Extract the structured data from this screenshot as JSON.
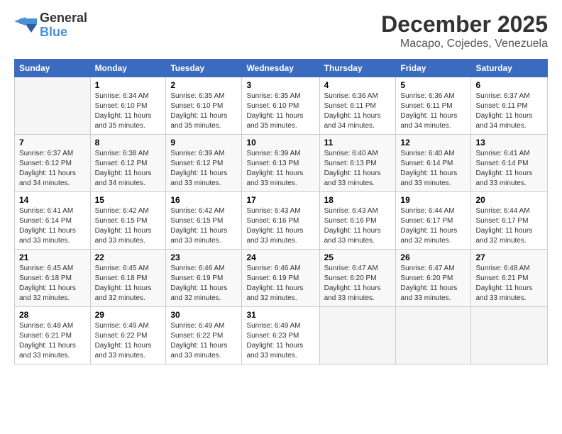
{
  "logo": {
    "general": "General",
    "blue": "Blue"
  },
  "title": {
    "month": "December 2025",
    "location": "Macapo, Cojedes, Venezuela"
  },
  "days_of_week": [
    "Sunday",
    "Monday",
    "Tuesday",
    "Wednesday",
    "Thursday",
    "Friday",
    "Saturday"
  ],
  "weeks": [
    [
      {
        "day": "",
        "info": ""
      },
      {
        "day": "1",
        "info": "Sunrise: 6:34 AM\nSunset: 6:10 PM\nDaylight: 11 hours\nand 35 minutes."
      },
      {
        "day": "2",
        "info": "Sunrise: 6:35 AM\nSunset: 6:10 PM\nDaylight: 11 hours\nand 35 minutes."
      },
      {
        "day": "3",
        "info": "Sunrise: 6:35 AM\nSunset: 6:10 PM\nDaylight: 11 hours\nand 35 minutes."
      },
      {
        "day": "4",
        "info": "Sunrise: 6:36 AM\nSunset: 6:11 PM\nDaylight: 11 hours\nand 34 minutes."
      },
      {
        "day": "5",
        "info": "Sunrise: 6:36 AM\nSunset: 6:11 PM\nDaylight: 11 hours\nand 34 minutes."
      },
      {
        "day": "6",
        "info": "Sunrise: 6:37 AM\nSunset: 6:11 PM\nDaylight: 11 hours\nand 34 minutes."
      }
    ],
    [
      {
        "day": "7",
        "info": "Sunrise: 6:37 AM\nSunset: 6:12 PM\nDaylight: 11 hours\nand 34 minutes."
      },
      {
        "day": "8",
        "info": "Sunrise: 6:38 AM\nSunset: 6:12 PM\nDaylight: 11 hours\nand 34 minutes."
      },
      {
        "day": "9",
        "info": "Sunrise: 6:39 AM\nSunset: 6:12 PM\nDaylight: 11 hours\nand 33 minutes."
      },
      {
        "day": "10",
        "info": "Sunrise: 6:39 AM\nSunset: 6:13 PM\nDaylight: 11 hours\nand 33 minutes."
      },
      {
        "day": "11",
        "info": "Sunrise: 6:40 AM\nSunset: 6:13 PM\nDaylight: 11 hours\nand 33 minutes."
      },
      {
        "day": "12",
        "info": "Sunrise: 6:40 AM\nSunset: 6:14 PM\nDaylight: 11 hours\nand 33 minutes."
      },
      {
        "day": "13",
        "info": "Sunrise: 6:41 AM\nSunset: 6:14 PM\nDaylight: 11 hours\nand 33 minutes."
      }
    ],
    [
      {
        "day": "14",
        "info": "Sunrise: 6:41 AM\nSunset: 6:14 PM\nDaylight: 11 hours\nand 33 minutes."
      },
      {
        "day": "15",
        "info": "Sunrise: 6:42 AM\nSunset: 6:15 PM\nDaylight: 11 hours\nand 33 minutes."
      },
      {
        "day": "16",
        "info": "Sunrise: 6:42 AM\nSunset: 6:15 PM\nDaylight: 11 hours\nand 33 minutes."
      },
      {
        "day": "17",
        "info": "Sunrise: 6:43 AM\nSunset: 6:16 PM\nDaylight: 11 hours\nand 33 minutes."
      },
      {
        "day": "18",
        "info": "Sunrise: 6:43 AM\nSunset: 6:16 PM\nDaylight: 11 hours\nand 33 minutes."
      },
      {
        "day": "19",
        "info": "Sunrise: 6:44 AM\nSunset: 6:17 PM\nDaylight: 11 hours\nand 32 minutes."
      },
      {
        "day": "20",
        "info": "Sunrise: 6:44 AM\nSunset: 6:17 PM\nDaylight: 11 hours\nand 32 minutes."
      }
    ],
    [
      {
        "day": "21",
        "info": "Sunrise: 6:45 AM\nSunset: 6:18 PM\nDaylight: 11 hours\nand 32 minutes."
      },
      {
        "day": "22",
        "info": "Sunrise: 6:45 AM\nSunset: 6:18 PM\nDaylight: 11 hours\nand 32 minutes."
      },
      {
        "day": "23",
        "info": "Sunrise: 6:46 AM\nSunset: 6:19 PM\nDaylight: 11 hours\nand 32 minutes."
      },
      {
        "day": "24",
        "info": "Sunrise: 6:46 AM\nSunset: 6:19 PM\nDaylight: 11 hours\nand 32 minutes."
      },
      {
        "day": "25",
        "info": "Sunrise: 6:47 AM\nSunset: 6:20 PM\nDaylight: 11 hours\nand 33 minutes."
      },
      {
        "day": "26",
        "info": "Sunrise: 6:47 AM\nSunset: 6:20 PM\nDaylight: 11 hours\nand 33 minutes."
      },
      {
        "day": "27",
        "info": "Sunrise: 6:48 AM\nSunset: 6:21 PM\nDaylight: 11 hours\nand 33 minutes."
      }
    ],
    [
      {
        "day": "28",
        "info": "Sunrise: 6:48 AM\nSunset: 6:21 PM\nDaylight: 11 hours\nand 33 minutes."
      },
      {
        "day": "29",
        "info": "Sunrise: 6:49 AM\nSunset: 6:22 PM\nDaylight: 11 hours\nand 33 minutes."
      },
      {
        "day": "30",
        "info": "Sunrise: 6:49 AM\nSunset: 6:22 PM\nDaylight: 11 hours\nand 33 minutes."
      },
      {
        "day": "31",
        "info": "Sunrise: 6:49 AM\nSunset: 6:23 PM\nDaylight: 11 hours\nand 33 minutes."
      },
      {
        "day": "",
        "info": ""
      },
      {
        "day": "",
        "info": ""
      },
      {
        "day": "",
        "info": ""
      }
    ]
  ]
}
